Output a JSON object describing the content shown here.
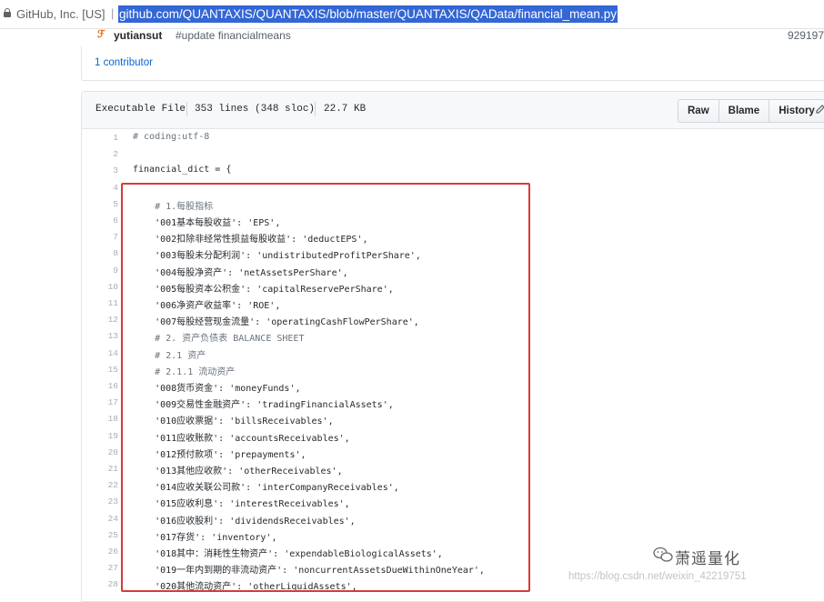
{
  "browser": {
    "site_identity": "GitHub, Inc. [US]",
    "separator": "|",
    "url": "github.com/QUANTAXIS/QUANTAXIS/blob/master/QUANTAXIS/QAData/financial_mean.py"
  },
  "commit": {
    "author": "yutiansut",
    "message": "#update financialmeans",
    "sha": "929197"
  },
  "contributors": "1 contributor",
  "file_header": {
    "mode": "Executable File",
    "lines": "353 lines (348 sloc)",
    "size": "22.7 KB",
    "buttons": {
      "raw": "Raw",
      "blame": "Blame",
      "history": "History"
    }
  },
  "code_lines": [
    {
      "n": "1",
      "text": "# coding:utf-8",
      "comment": true
    },
    {
      "n": "2",
      "text": "",
      "comment": false
    },
    {
      "n": "3",
      "text": "financial_dict = {",
      "comment": false
    },
    {
      "n": "4",
      "text": "",
      "comment": false
    },
    {
      "n": "5",
      "text": "    # 1.每股指标",
      "comment": true
    },
    {
      "n": "6",
      "text": "    '001基本每股收益': 'EPS',",
      "comment": false
    },
    {
      "n": "7",
      "text": "    '002扣除非经常性损益每股收益': 'deductEPS',",
      "comment": false
    },
    {
      "n": "8",
      "text": "    '003每股未分配利润': 'undistributedProfitPerShare',",
      "comment": false
    },
    {
      "n": "9",
      "text": "    '004每股净资产': 'netAssetsPerShare',",
      "comment": false
    },
    {
      "n": "10",
      "text": "    '005每股资本公积金': 'capitalReservePerShare',",
      "comment": false
    },
    {
      "n": "11",
      "text": "    '006净资产收益率': 'ROE',",
      "comment": false
    },
    {
      "n": "12",
      "text": "    '007每股经营现金流量': 'operatingCashFlowPerShare',",
      "comment": false
    },
    {
      "n": "13",
      "text": "    # 2. 资产负债表 BALANCE SHEET",
      "comment": true
    },
    {
      "n": "14",
      "text": "    # 2.1 资产",
      "comment": true
    },
    {
      "n": "15",
      "text": "    # 2.1.1 流动资产",
      "comment": true
    },
    {
      "n": "16",
      "text": "    '008货币资金': 'moneyFunds',",
      "comment": false
    },
    {
      "n": "17",
      "text": "    '009交易性金融资产': 'tradingFinancialAssets',",
      "comment": false
    },
    {
      "n": "18",
      "text": "    '010应收票据': 'billsReceivables',",
      "comment": false
    },
    {
      "n": "19",
      "text": "    '011应收账款': 'accountsReceivables',",
      "comment": false
    },
    {
      "n": "20",
      "text": "    '012预付款项': 'prepayments',",
      "comment": false
    },
    {
      "n": "21",
      "text": "    '013其他应收款': 'otherReceivables',",
      "comment": false
    },
    {
      "n": "22",
      "text": "    '014应收关联公司款': 'interCompanyReceivables',",
      "comment": false
    },
    {
      "n": "23",
      "text": "    '015应收利息': 'interestReceivables',",
      "comment": false
    },
    {
      "n": "24",
      "text": "    '016应收股利': 'dividendsReceivables',",
      "comment": false
    },
    {
      "n": "25",
      "text": "    '017存货': 'inventory',",
      "comment": false
    },
    {
      "n": "26",
      "text": "    '018其中：消耗性生物资产': 'expendableBiologicalAssets',",
      "comment": false
    },
    {
      "n": "27",
      "text": "    '019一年内到期的非流动资产': 'noncurrentAssetsDueWithinOneYear',",
      "comment": false
    },
    {
      "n": "28",
      "text": "    '020其他流动资产': 'otherLiquidAssets',",
      "comment": false
    }
  ],
  "watermark": {
    "brand": "萧遥量化",
    "url": "https://blog.csdn.net/weixin_42219751"
  },
  "colors": {
    "highlight_border": "#d73a3a",
    "url_selection": "#3367d6",
    "link": "#0366d6"
  }
}
